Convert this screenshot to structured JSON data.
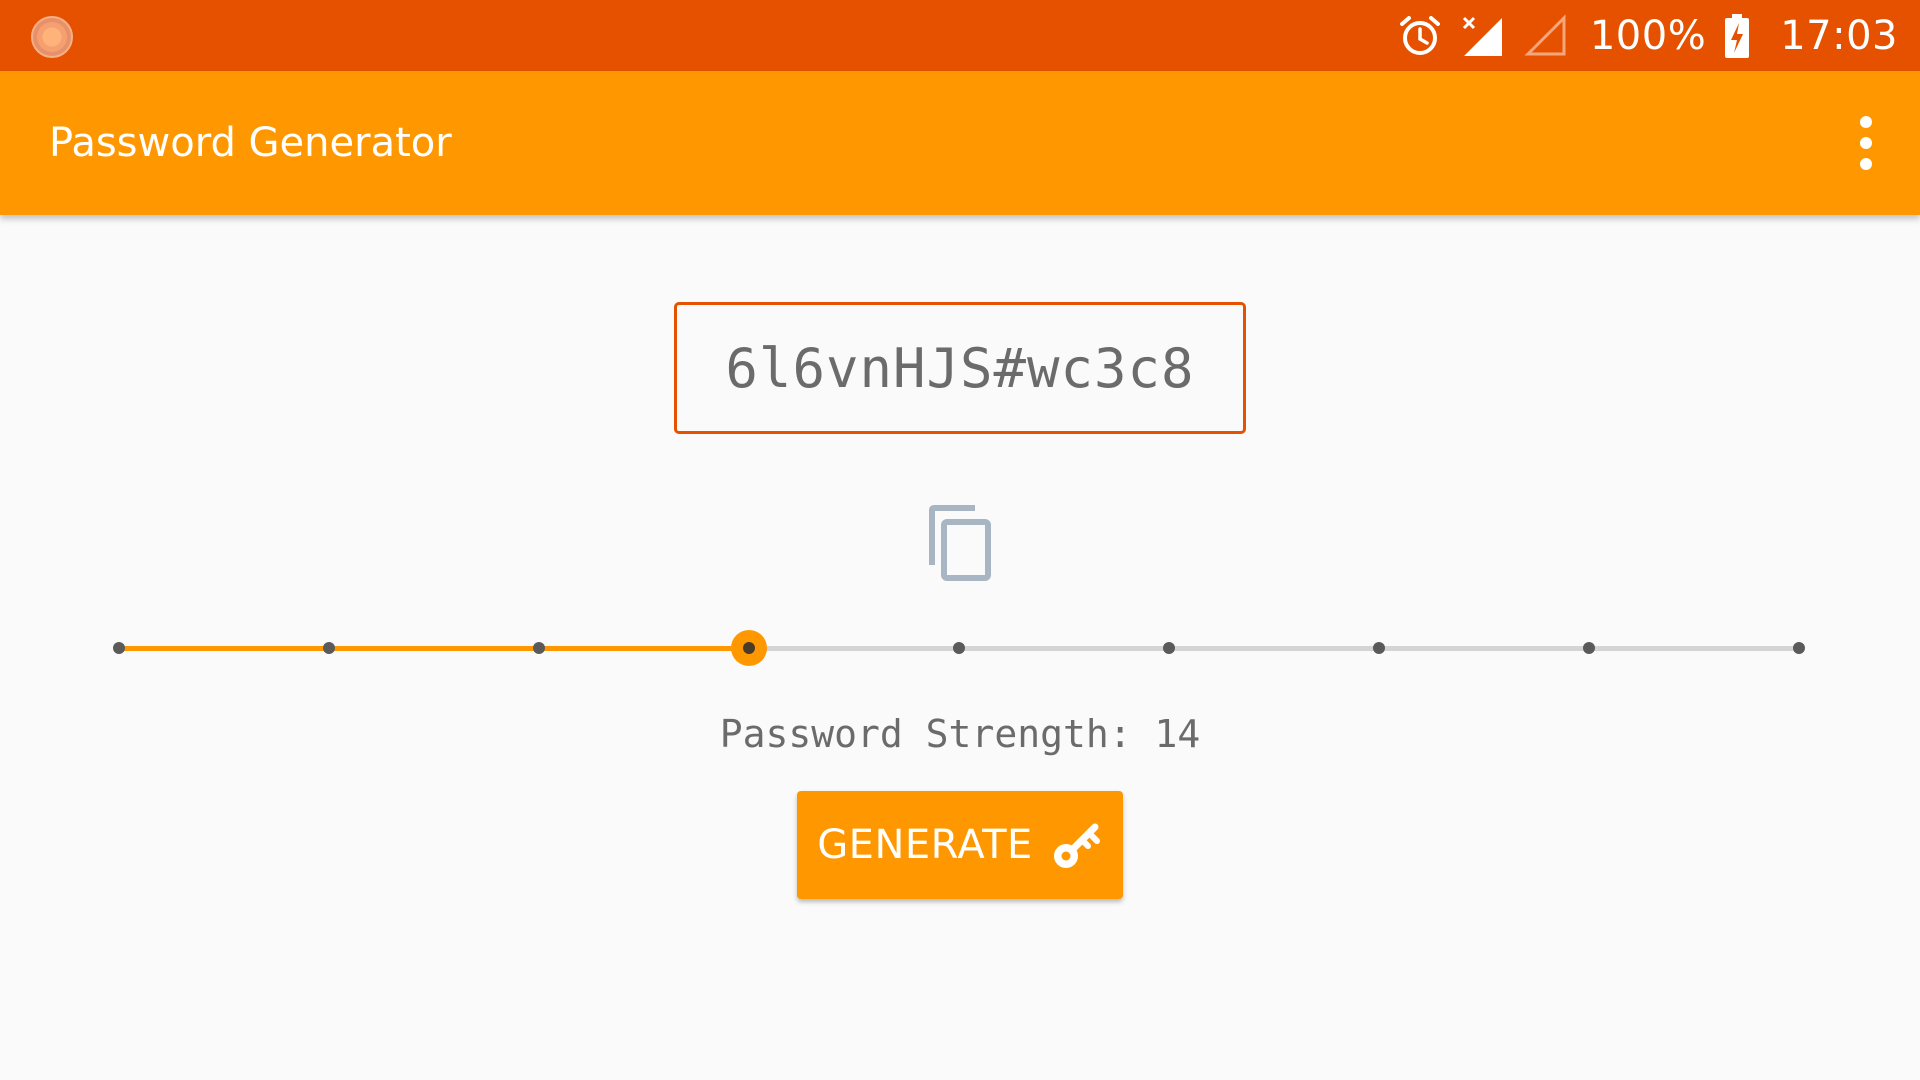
{
  "status_bar": {
    "battery_percent": "100%",
    "time": "17:03",
    "icons": [
      "app-notification-icon",
      "alarm-icon",
      "signal-no-data-icon",
      "signal-empty-icon",
      "battery-charging-icon"
    ]
  },
  "app_bar": {
    "title": "Password Generator",
    "menu_icon": "more-vert-icon"
  },
  "password": {
    "value": "6l6vnHJS#wc3c8"
  },
  "copy": {
    "icon": "copy-icon"
  },
  "strength_slider": {
    "steps": 9,
    "selected_step_index": 3
  },
  "strength_label": "Password Strength: 14",
  "generate_button": {
    "label": "GENERATE",
    "icon": "key-icon"
  },
  "colors": {
    "status_bar": "#e65100",
    "app_bar": "#ff9800",
    "accent": "#ff9800",
    "field_border": "#e65100",
    "background": "#fafafa"
  }
}
